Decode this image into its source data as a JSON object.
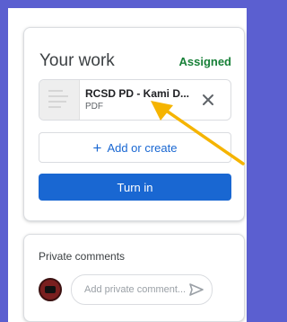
{
  "work": {
    "title": "Your work",
    "status": "Assigned",
    "attachment": {
      "name": "RCSD PD - Kami D...",
      "type": "PDF"
    },
    "add_label": "Add or create",
    "add_icon": "plus-icon",
    "turn_in_label": "Turn in"
  },
  "comments": {
    "title": "Private comments",
    "placeholder": "Add private comment...",
    "send_icon": "send-icon"
  },
  "colors": {
    "background": "#5b5fd0",
    "assigned": "#188038",
    "primary": "#1967d2",
    "annotation_arrow": "#f5b400"
  }
}
